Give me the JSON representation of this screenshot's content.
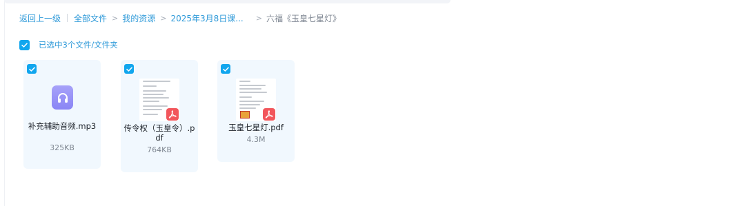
{
  "breadcrumb": {
    "back": "返回上一级",
    "root": "全部文件",
    "items": [
      "我的资源",
      "2025年3月8日课...",
      "六福《玉皇七星灯》"
    ]
  },
  "selection": {
    "label": "已选中3个文件/文件夹"
  },
  "files": [
    {
      "name": "补充辅助音频.mp3",
      "size": "325KB",
      "type": "audio",
      "icon": "audio-file-icon",
      "selected": true
    },
    {
      "name": "传令权（玉皇令）.pdf",
      "size": "764KB",
      "type": "pdf",
      "icon": "pdf-file-icon",
      "selected": true
    },
    {
      "name": "玉皇七星灯.pdf",
      "size": "4.3M",
      "type": "pdf",
      "icon": "pdf-file-icon",
      "selected": true
    }
  ],
  "colors": {
    "accent": "#11a6ee",
    "link": "#2f9ad9",
    "card_bg": "#f1f8fe",
    "audio_icon": "#8a85f5",
    "pdf_badge": "#f2565c"
  }
}
